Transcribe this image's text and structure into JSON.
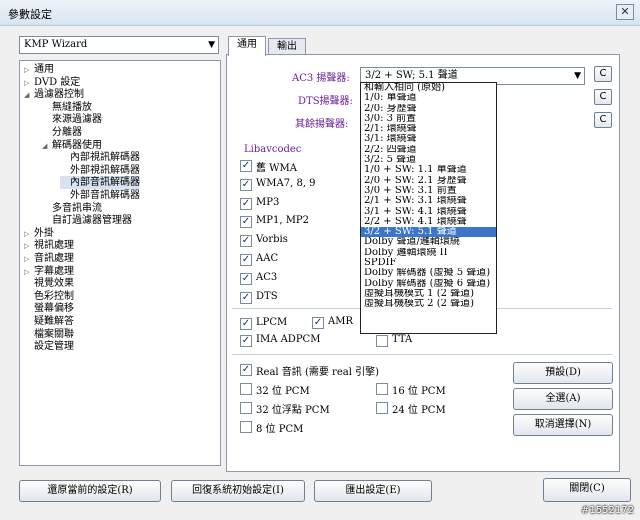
{
  "window": {
    "title": "參數設定",
    "close_label": "✕"
  },
  "preset": {
    "value": "KMP Wizard"
  },
  "tree": [
    {
      "label": "通用",
      "depth": 0,
      "toggle": "▷"
    },
    {
      "label": "DVD 設定",
      "depth": 0,
      "toggle": "▷"
    },
    {
      "label": "過濾器控制",
      "depth": 0,
      "toggle": "◢"
    },
    {
      "label": "無縫播放",
      "depth": 1,
      "toggle": ""
    },
    {
      "label": "來源過濾器",
      "depth": 1,
      "toggle": ""
    },
    {
      "label": "分離器",
      "depth": 1,
      "toggle": ""
    },
    {
      "label": "解碼器使用",
      "depth": 1,
      "toggle": "◢"
    },
    {
      "label": "內部視訊解碼器",
      "depth": 2,
      "toggle": ""
    },
    {
      "label": "外部視訊解碼器",
      "depth": 2,
      "toggle": ""
    },
    {
      "label": "內部音訊解碼器",
      "depth": 2,
      "toggle": "",
      "selected": true
    },
    {
      "label": "外部音訊解碼器",
      "depth": 2,
      "toggle": ""
    },
    {
      "label": "多音訊串流",
      "depth": 1,
      "toggle": ""
    },
    {
      "label": "自訂過濾器管理器",
      "depth": 1,
      "toggle": ""
    },
    {
      "label": "外掛",
      "depth": 0,
      "toggle": "▷"
    },
    {
      "label": "視訊處理",
      "depth": 0,
      "toggle": "▷"
    },
    {
      "label": "音訊處理",
      "depth": 0,
      "toggle": "▷"
    },
    {
      "label": "字幕處理",
      "depth": 0,
      "toggle": "▷"
    },
    {
      "label": "視覺效果",
      "depth": 0,
      "toggle": ""
    },
    {
      "label": "色彩控制",
      "depth": 0,
      "toggle": ""
    },
    {
      "label": "螢幕偏移",
      "depth": 0,
      "toggle": ""
    },
    {
      "label": "疑難解答",
      "depth": 0,
      "toggle": ""
    },
    {
      "label": "檔案關聯",
      "depth": 0,
      "toggle": ""
    },
    {
      "label": "設定管理",
      "depth": 0,
      "toggle": ""
    }
  ],
  "tabs": [
    "通用",
    "輸出"
  ],
  "speakers": {
    "ac3_label": "AC3 揚聲器:",
    "ac3_value": "3/2 + SW; 5.1 聲道",
    "dts_label": "DTS揚聲器:",
    "other_label": "其餘揚聲器:",
    "c_button": "C"
  },
  "dropdown_options": [
    "和輸入相同 (原始)",
    "1/0: 單聲道",
    "2/0: 身歷聲",
    "3/0: 3 前置",
    "2/1: 環繞聲",
    "3/1: 環繞聲",
    "2/2: 四聲道",
    "3/2: 5 聲道",
    "1/0 + SW: 1.1 單聲道",
    "2/0 + SW: 2.1 身歷聲",
    "3/0 + SW: 3.1 前置",
    "2/1 + SW: 3.1 環繞聲",
    "3/1 + SW: 4.1 環繞聲",
    "2/2 + SW: 4.1 環繞聲",
    "3/2 + SW: 5.1 聲道",
    "Dolby 聲道/邏輯環繞",
    "Dolby 邏輯環繞 II",
    "SPDIF",
    "Dolby 解碼器 (虛擬 5 聲道)",
    "Dolby 解碼器 (虛擬 6 聲道)",
    "虛擬耳機模式 1 (2 聲道)",
    "虛擬耳機模式 2 (2 聲道)"
  ],
  "dropdown_highlight_index": 14,
  "libav_label": "Libavcodec",
  "codecs": [
    {
      "label": "舊 WMA",
      "checked": true
    },
    {
      "label": "WMA7, 8, 9",
      "checked": true
    },
    {
      "label": "MP3",
      "checked": true
    },
    {
      "label": "MP1, MP2",
      "checked": true
    },
    {
      "label": "Vorbis",
      "checked": true
    },
    {
      "label": "AAC",
      "checked": true
    },
    {
      "label": "AC3",
      "checked": true
    },
    {
      "label": "DTS",
      "checked": true
    }
  ],
  "pcm_row": [
    {
      "label": "LPCM",
      "checked": true
    },
    {
      "label": "AMR",
      "checked": true
    },
    {
      "label": "IMA ADPCM",
      "checked": true
    },
    {
      "label": "TTA",
      "checked": false
    }
  ],
  "real_audio": {
    "label": "Real 音訊 (需要 real 引擎)",
    "checked": true
  },
  "pcm_options": [
    {
      "label": "32 位 PCM",
      "checked": false
    },
    {
      "label": "16 位 PCM",
      "checked": false
    },
    {
      "label": "32 位浮點 PCM",
      "checked": false
    },
    {
      "label": "24 位 PCM",
      "checked": false
    },
    {
      "label": "8 位 PCM",
      "checked": false
    }
  ],
  "side_buttons": {
    "preset": "預設(D)",
    "select_all": "全選(A)",
    "deselect": "取消選擇(N)"
  },
  "bottom_buttons": {
    "restore": "還原當前的設定(R)",
    "reset": "回復系統初始設定(I)",
    "export": "匯出設定(E)",
    "close": "關閉(C)"
  },
  "watermark": "#1552172",
  "colors": {
    "label_purple": "#6a1f9a",
    "highlight": "#3c76c8"
  }
}
